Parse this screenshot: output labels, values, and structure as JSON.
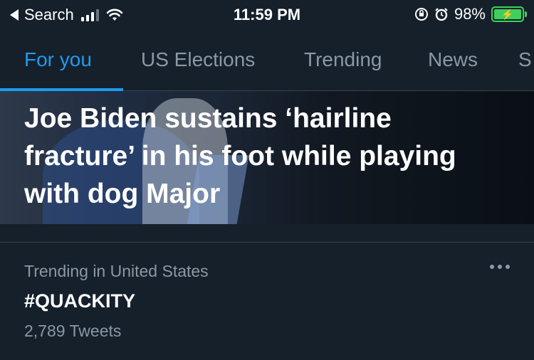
{
  "status_bar": {
    "back_app": "Search",
    "time": "11:59 PM",
    "battery": "98%"
  },
  "tabs": [
    {
      "label": "For you",
      "active": true
    },
    {
      "label": "US Elections"
    },
    {
      "label": "Trending"
    },
    {
      "label": "News"
    },
    {
      "label": "S"
    }
  ],
  "hero": {
    "headline": "Joe Biden sustains ‘hairline fracture’ in his foot while playing with dog Major"
  },
  "trend": {
    "context": "Trending in United States",
    "name": "#QUACKITY",
    "count": "2,789 Tweets"
  },
  "colors": {
    "background": "#15202b",
    "accent": "#1d9bf0",
    "secondary_text": "#8b98a5",
    "battery": "#3fd05c"
  }
}
